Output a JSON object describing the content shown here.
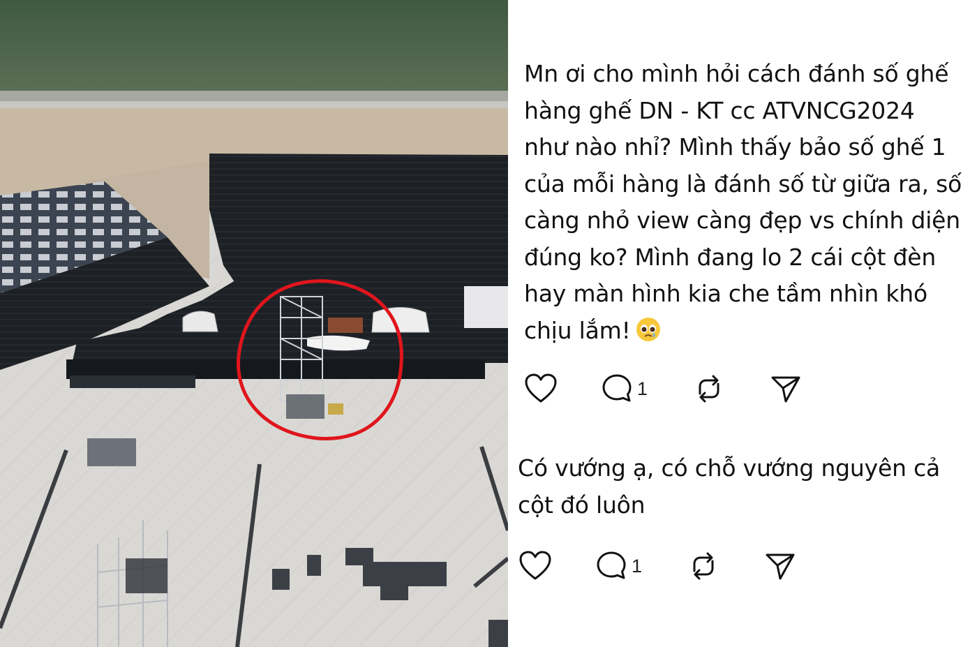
{
  "post": {
    "text": "Mn ơi cho mình hỏi cách đánh số ghế hàng ghế DN - KT cc ATVNCG2024 như nào nhỉ? Mình thấy bảo số ghế 1 của mỗi hàng là đánh số từ giữa ra, số càng nhỏ view càng đẹp vs chính diện đúng ko? Mình đang lo 2 cái cột đèn hay màn hình kia che tầm nhìn khó chịu lắm!",
    "emoji_icon": "pleading-face-emoji",
    "actions": {
      "like_icon": "heart-icon",
      "comment_icon": "comment-bubble-icon",
      "comment_count": "1",
      "repost_icon": "repost-icon",
      "share_icon": "send-icon"
    }
  },
  "reply": {
    "text": "Có vướng ạ, có chỗ vướng nguyên cả cột đó luôn",
    "actions": {
      "like_icon": "heart-icon",
      "comment_icon": "comment-bubble-icon",
      "comment_count": "1",
      "repost_icon": "repost-icon",
      "share_icon": "send-icon"
    }
  },
  "photo": {
    "description_icon": "aerial-stadium-photo",
    "highlight_color": "#e0151c"
  }
}
